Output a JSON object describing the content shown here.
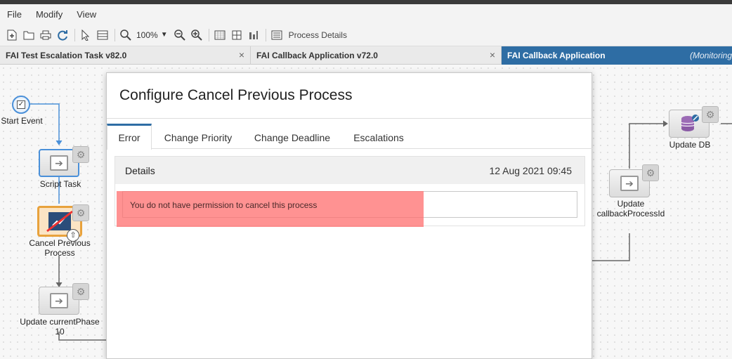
{
  "menu": {
    "items": [
      "File",
      "Modify",
      "View"
    ]
  },
  "toolbar": {
    "zoom": "100%",
    "process_details_label": "Process Details"
  },
  "tabs": [
    {
      "label": "FAI Test Escalation Task v82.0"
    },
    {
      "label": "FAI Callback Application v72.0"
    },
    {
      "label": "FAI Callback Application",
      "suffix": "(Monitoring"
    }
  ],
  "close_glyph": "×",
  "canvas": {
    "nodes": {
      "start_event": "Start Event",
      "script_task": "Script Task",
      "cancel_previous_1": "Cancel Previous",
      "cancel_previous_2": "Process",
      "update_phase_1": "Update currentPhase",
      "update_phase_2": "10",
      "update_db": "Update DB",
      "update_callback_1": "Update",
      "update_callback_2": "callbackProcessId"
    }
  },
  "dialog": {
    "title": "Configure Cancel Previous Process",
    "tabs": [
      "Error",
      "Change Priority",
      "Change Deadline",
      "Escalations"
    ],
    "details": {
      "heading": "Details",
      "timestamp": "12 Aug 2021 09:45",
      "message": "You do not have permission to cancel this process"
    }
  },
  "colors": {
    "accent": "#2e6da4",
    "error_highlight": "#ff8a8a",
    "selected_border": "#4a90d9"
  }
}
